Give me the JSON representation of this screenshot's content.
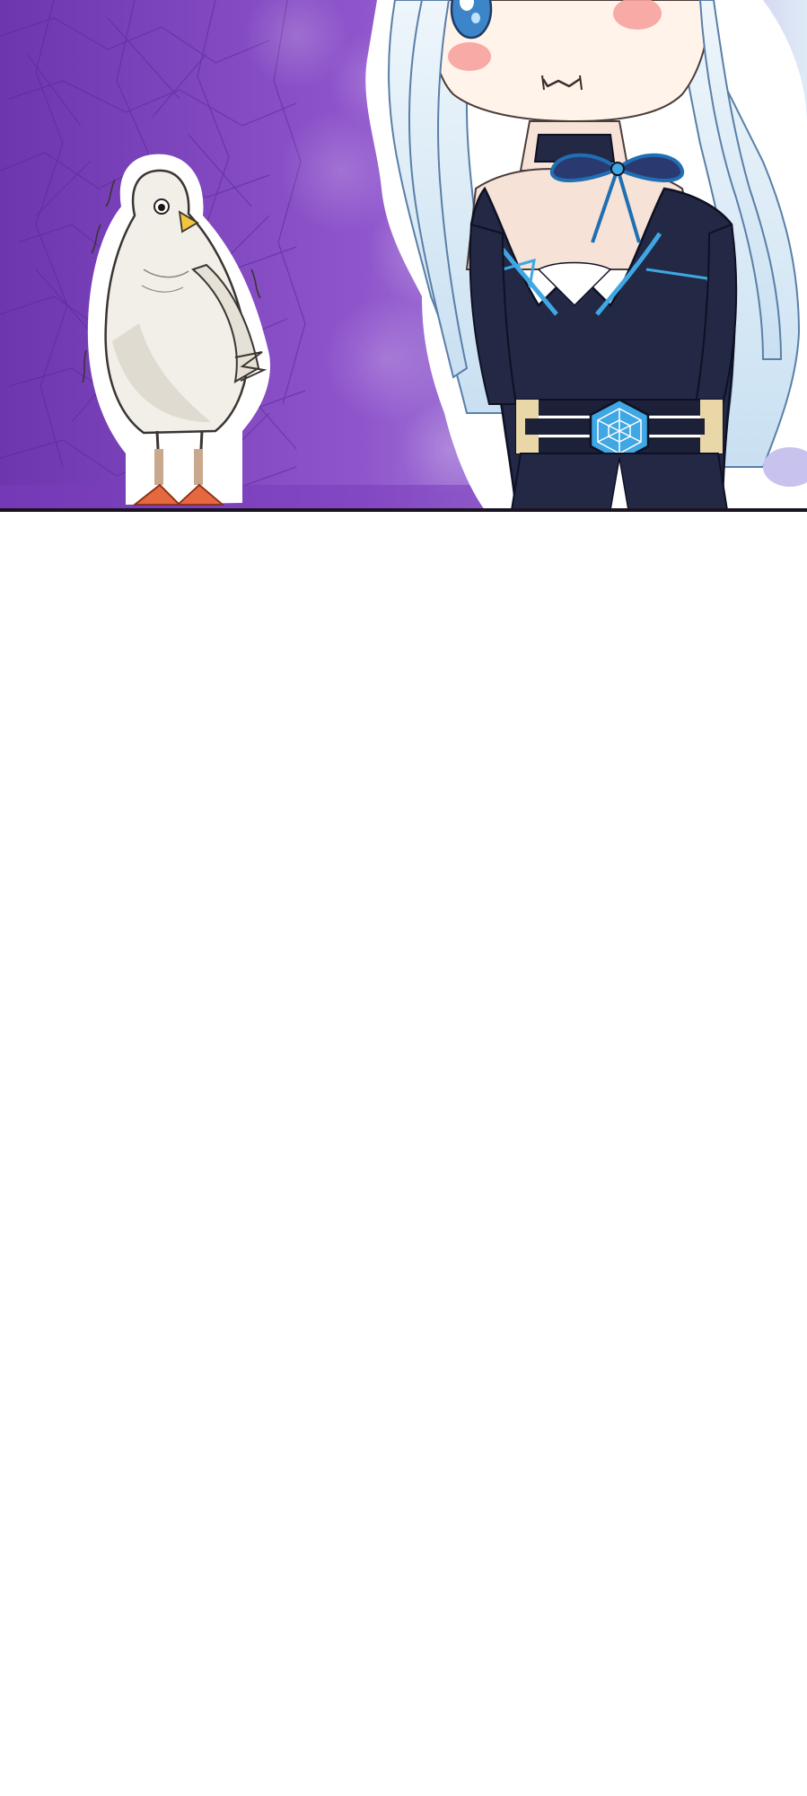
{
  "panel": {
    "background_color": "#8a4fc6",
    "accent_color": "#c7b6ec",
    "characters": [
      "pigeon",
      "girl-chibi"
    ]
  },
  "colors": {
    "hair": "#dfeef8",
    "dress": "#232845",
    "dress_trim": "#3fa7e3",
    "belt_gold": "#e9d7a8",
    "blush": "#f7a2a0",
    "pigeon_body": "#f1efe8",
    "pigeon_beak": "#f2c53c",
    "pigeon_feet": "#e5683f"
  }
}
